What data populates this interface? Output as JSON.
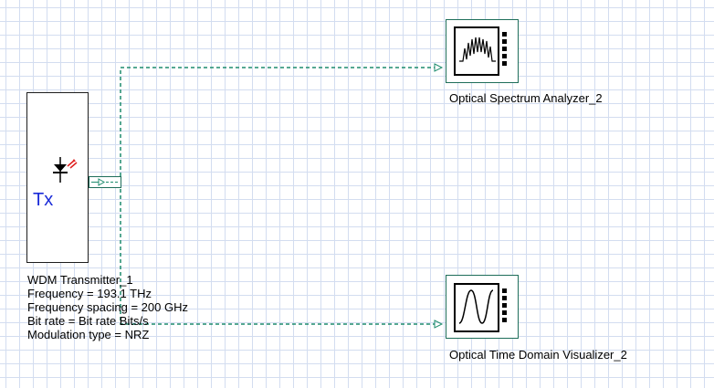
{
  "transmitter": {
    "symbol_text": "Tx",
    "name": "WDM Transmitter_1",
    "params": [
      "Frequency = 193.1  THz",
      "Frequency spacing = 200  GHz",
      "Bit rate = Bit rate  Bits/s",
      "Modulation type = NRZ"
    ]
  },
  "spectrum_analyzer": {
    "name": "Optical Spectrum Analyzer_2",
    "icon": "spectrum-trace-icon"
  },
  "time_domain_visualizer": {
    "name": "Optical Time Domain Visualizer_2",
    "icon": "sine-wave-icon"
  },
  "colors": {
    "grid": "#d3ddf0",
    "wire": "#1e8c6e",
    "tx_text": "#1a2bd8",
    "laser_red": "#e02020"
  }
}
